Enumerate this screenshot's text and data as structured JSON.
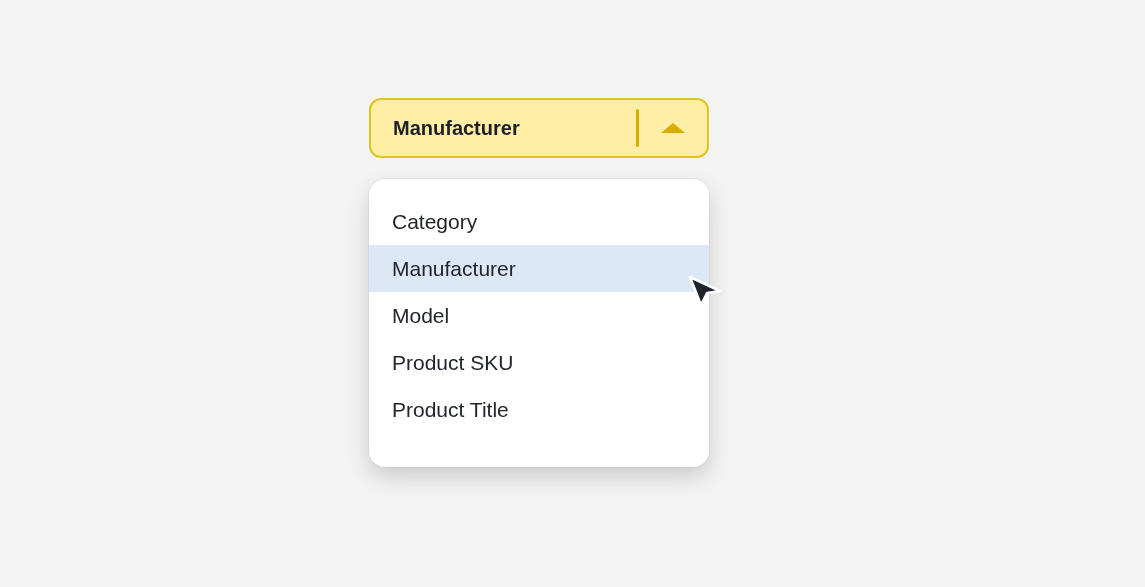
{
  "select": {
    "value": "Manufacturer",
    "expanded": true
  },
  "options": [
    {
      "label": "Category",
      "selected": false
    },
    {
      "label": "Manufacturer",
      "selected": true
    },
    {
      "label": "Model",
      "selected": false
    },
    {
      "label": "Product SKU",
      "selected": false
    },
    {
      "label": "Product Title",
      "selected": false
    }
  ]
}
